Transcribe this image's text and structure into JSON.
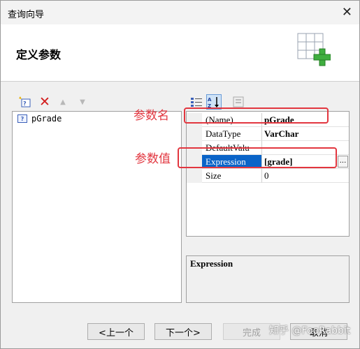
{
  "window": {
    "title": "查询向导"
  },
  "header": {
    "title": "定义参数"
  },
  "param_list": {
    "items": [
      {
        "icon": "question-parameter-icon",
        "label": "pGrade"
      }
    ]
  },
  "properties": {
    "rows": [
      {
        "name": "(Name)",
        "value": "pGrade"
      },
      {
        "name": "DataType",
        "value": "VarChar"
      },
      {
        "name": "DefaultValu",
        "value": ""
      },
      {
        "name": "Expression",
        "value": "[grade]"
      },
      {
        "name": "Size",
        "value": "0"
      }
    ],
    "ellipsis": "...",
    "description": "Expression"
  },
  "annotations": {
    "param_name": "参数名",
    "param_value": "参数值"
  },
  "buttons": {
    "prev": "<上一个",
    "next": "下一个>",
    "finish": "完成",
    "cancel": "取消"
  },
  "watermark": "知乎 @FooRabbit",
  "colors": {
    "annotation": "#e2363f",
    "selection": "#0a64c8"
  }
}
